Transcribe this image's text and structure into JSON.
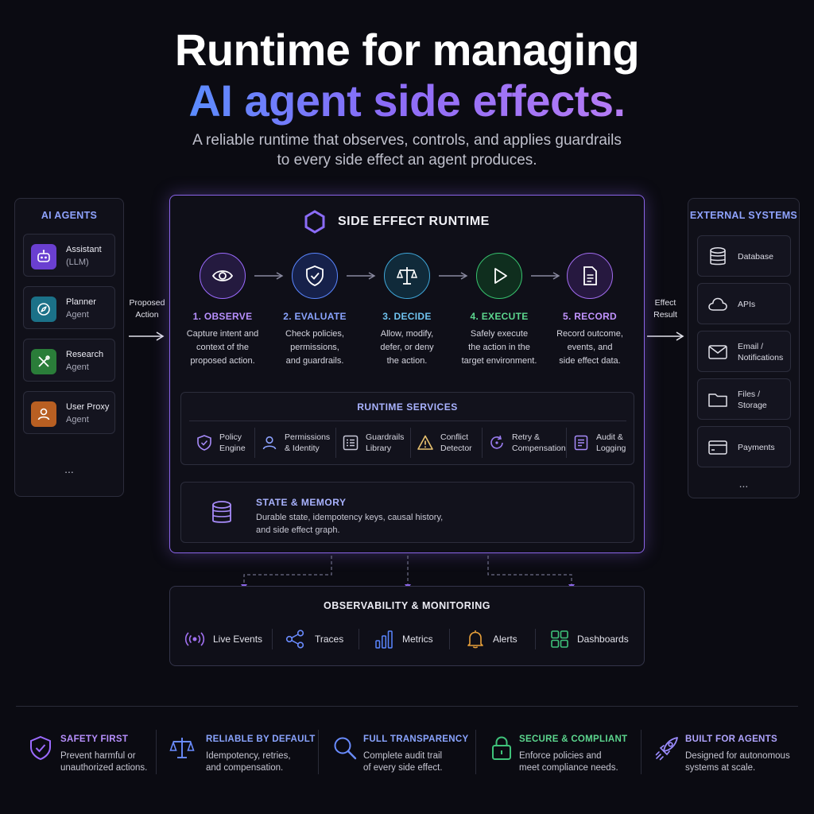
{
  "hero": {
    "line1": "Runtime for managing",
    "line2": "AI agent side effects.",
    "subtitle_line1": "A reliable runtime that observes, controls, and applies guardrails",
    "subtitle_line2": "to every side effect an agent produces."
  },
  "agents": {
    "title": "AI AGENTS",
    "items": [
      {
        "name": "Assistant",
        "sub": "(LLM)",
        "icon": "robot-icon",
        "color": "#7c4ddb"
      },
      {
        "name": "Planner",
        "sub": "Agent",
        "icon": "compass-icon",
        "color": "#1e7f95"
      },
      {
        "name": "Research",
        "sub": "Agent",
        "icon": "tools-icon",
        "color": "#2f8a3f"
      },
      {
        "name": "User Proxy",
        "sub": "Agent",
        "icon": "user-icon",
        "color": "#c46a2a"
      }
    ],
    "more": "..."
  },
  "flow": {
    "left_line1": "Proposed",
    "left_line2": "Action",
    "right_line1": "Effect",
    "right_line2": "Result"
  },
  "runtime": {
    "title": "SIDE EFFECT RUNTIME",
    "steps": [
      {
        "title": "1. OBSERVE",
        "l1": "Capture intent and",
        "l2": "context of the",
        "l3": "proposed action.",
        "color": "#9c6bff",
        "icon": "eye-icon"
      },
      {
        "title": "2. EVALUATE",
        "l1": "Check policies,",
        "l2": "permissions,",
        "l3": "and guardrails.",
        "color": "#5a86ff",
        "icon": "shield-check-icon"
      },
      {
        "title": "3. DECIDE",
        "l1": "Allow, modify,",
        "l2": "defer, or deny",
        "l3": "the action.",
        "color": "#3fa6d8",
        "icon": "scale-icon"
      },
      {
        "title": "4. EXECUTE",
        "l1": "Safely execute",
        "l2": "the action in the",
        "l3": "target environment.",
        "color": "#37c26e",
        "icon": "play-icon"
      },
      {
        "title": "5. RECORD",
        "l1": "Record outcome,",
        "l2": "events, and",
        "l3": "side effect data.",
        "color": "#a26cf0",
        "icon": "document-icon"
      }
    ],
    "services": {
      "title": "RUNTIME SERVICES",
      "items": [
        {
          "l1": "Policy",
          "l2": "Engine",
          "icon": "shield-icon",
          "color": "#a78bfa"
        },
        {
          "l1": "Permissions",
          "l2": "& Identity",
          "icon": "user-icon",
          "color": "#8da2ff"
        },
        {
          "l1": "Guardrails",
          "l2": "Library",
          "icon": "list-icon",
          "color": "#c8c8d8"
        },
        {
          "l1": "Conflict",
          "l2": "Detector",
          "icon": "warning-icon",
          "color": "#e8c270"
        },
        {
          "l1": "Retry &",
          "l2": "Compensation",
          "icon": "retry-icon",
          "color": "#9a7cf0"
        },
        {
          "l1": "Audit &",
          "l2": "Logging",
          "icon": "log-icon",
          "color": "#a78bfa"
        }
      ]
    },
    "memory": {
      "title": "STATE & MEMORY",
      "desc_line1": "Durable state, idempotency keys, causal history,",
      "desc_line2": "and side effect graph."
    }
  },
  "external": {
    "title": "EXTERNAL SYSTEMS",
    "items": [
      {
        "l1": "Database",
        "l2": "",
        "icon": "database-icon"
      },
      {
        "l1": "APIs",
        "l2": "",
        "icon": "cloud-icon"
      },
      {
        "l1": "Email /",
        "l2": "Notifications",
        "icon": "mail-icon"
      },
      {
        "l1": "Files /",
        "l2": "Storage",
        "icon": "folder-icon"
      },
      {
        "l1": "Payments",
        "l2": "",
        "icon": "card-icon"
      }
    ],
    "more": "..."
  },
  "observability": {
    "title": "OBSERVABILITY & MONITORING",
    "items": [
      {
        "label": "Live Events",
        "icon": "broadcast-icon",
        "color": "#a070f0"
      },
      {
        "label": "Traces",
        "icon": "share-icon",
        "color": "#6a8cff"
      },
      {
        "label": "Metrics",
        "icon": "bar-chart-icon",
        "color": "#5a86ff"
      },
      {
        "label": "Alerts",
        "icon": "bell-icon",
        "color": "#e8a03a"
      },
      {
        "label": "Dashboards",
        "icon": "grid-icon",
        "color": "#3fc27a"
      }
    ]
  },
  "features": [
    {
      "title": "SAFETY FIRST",
      "l1": "Prevent harmful or",
      "l2": "unauthorized actions.",
      "icon": "shield-check-icon",
      "color": "#9c6bff"
    },
    {
      "title": "RELIABLE BY DEFAULT",
      "l1": "Idempotency, retries,",
      "l2": "and compensation.",
      "icon": "scale-icon",
      "color": "#6a8cff"
    },
    {
      "title": "FULL TRANSPARENCY",
      "l1": "Complete audit trail",
      "l2": "of every side effect.",
      "icon": "magnifier-icon",
      "color": "#6a8cff"
    },
    {
      "title": "SECURE & COMPLIANT",
      "l1": "Enforce policies and",
      "l2": "meet compliance needs.",
      "icon": "lock-icon",
      "color": "#3fc27a"
    },
    {
      "title": "BUILT FOR AGENTS",
      "l1": "Designed for autonomous",
      "l2": "systems at scale.",
      "icon": "rocket-icon",
      "color": "#9c8cff"
    }
  ]
}
